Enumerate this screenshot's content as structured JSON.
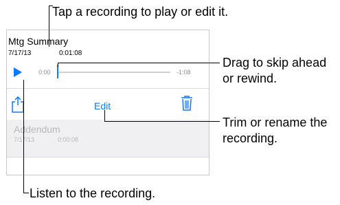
{
  "callouts": {
    "top": "Tap a recording to play or edit it.",
    "drag": "Drag to skip ahead\nor rewind.",
    "trim": "Trim or rename the\nrecording.",
    "listen": "Listen to the recording."
  },
  "recording": {
    "title": "Mtg Summary",
    "date": "7/17/13",
    "duration": "0:01:08",
    "time_start": "0:00",
    "time_end": "-1:08",
    "edit_label": "Edit"
  },
  "recording2": {
    "title": "Addendum",
    "date": "7/17/13",
    "duration": "0:00:08"
  },
  "colors": {
    "accent": "#0a7aff",
    "muted": "#b8b8bc"
  },
  "icons": [
    "play-icon",
    "share-icon",
    "trash-icon"
  ]
}
